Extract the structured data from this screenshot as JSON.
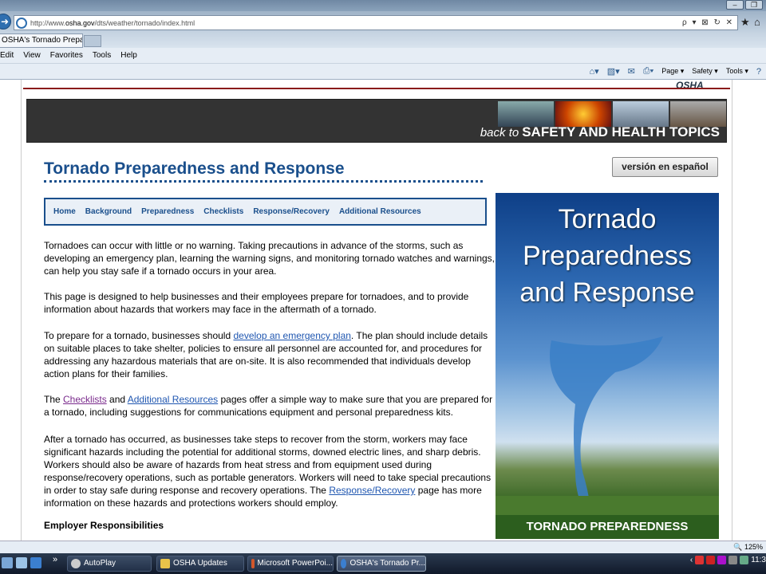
{
  "browser": {
    "url_prefix": "http://www.",
    "url_domain": "osha.gov",
    "url_path": "/dts/weather/tornado/index.html",
    "url_tools": "ρ ▾ ⊠ ↻ ✕",
    "tab_title": "OSHA's Tornado Preparedn...",
    "menu": [
      "Edit",
      "View",
      "Favorites",
      "Tools",
      "Help"
    ],
    "commands": {
      "page": "Page ▾",
      "safety": "Safety ▾",
      "tools": "Tools ▾"
    },
    "zoom": "125%"
  },
  "site": {
    "logo": "OSHA",
    "banner_prefix": "back to",
    "banner_text": "SAFETY AND HEALTH TOPICS",
    "page_title": "Tornado Preparedness and Response",
    "spanish_button": "versión en español",
    "subnav": [
      "Home",
      "Background",
      "Preparedness",
      "Checklists",
      "Response/Recovery",
      "Additional Resources"
    ],
    "paragraphs": {
      "p1": "Tornadoes can occur with little or no warning. Taking precautions in advance of the storms, such as developing an emergency plan, learning the warning signs, and monitoring tornado watches and warnings, can help you stay safe if a tornado occurs in your area.",
      "p2": "This page is designed to help businesses and their employees prepare for tornadoes, and to provide information about hazards that workers may face in the aftermath of a tornado.",
      "p3_a": "To prepare for a tornado, businesses should ",
      "p3_link": "develop an emergency plan",
      "p3_b": ". The plan should include details on suitable places to take shelter, policies to ensure all personnel are accounted for, and procedures for addressing any hazardous materials that are on-site. It is also recommended that individuals develop action plans for their families.",
      "p4_a": "The ",
      "p4_link1": "Checklists",
      "p4_b": " and ",
      "p4_link2": "Additional Resources",
      "p4_c": " pages offer a simple way to make sure that you are prepared for a tornado, including suggestions for communications equipment and personal preparedness kits.",
      "p5_a": "After a tornado has occurred, as businesses take steps to recover from the storm, workers may face significant hazards including the potential for additional storms, downed electric lines, and sharp debris. Workers should also be aware of hazards from heat stress and from equipment used during response/recovery operations, such as portable generators. Workers will need to take special precautions in order to stay safe during response and recovery operations. The ",
      "p5_link": "Response/Recovery",
      "p5_b": " page has more information on these hazards and protections workers should employ."
    },
    "section_heading": "Employer Responsibilities",
    "poster": {
      "line1": "Tornado",
      "line2": "Preparedness",
      "line3": "and Response",
      "footer": "TORNADO PREPAREDNESS"
    }
  },
  "taskbar": {
    "chevron": "»",
    "items": [
      "AutoPlay",
      "OSHA Updates",
      "Microsoft PowerPoi...",
      "OSHA's Tornado Pr..."
    ],
    "clock": "11:3"
  },
  "colors": {
    "link": "#1f56b0",
    "visited": "#7a2a8c",
    "title_blue": "#1a4f8c"
  }
}
